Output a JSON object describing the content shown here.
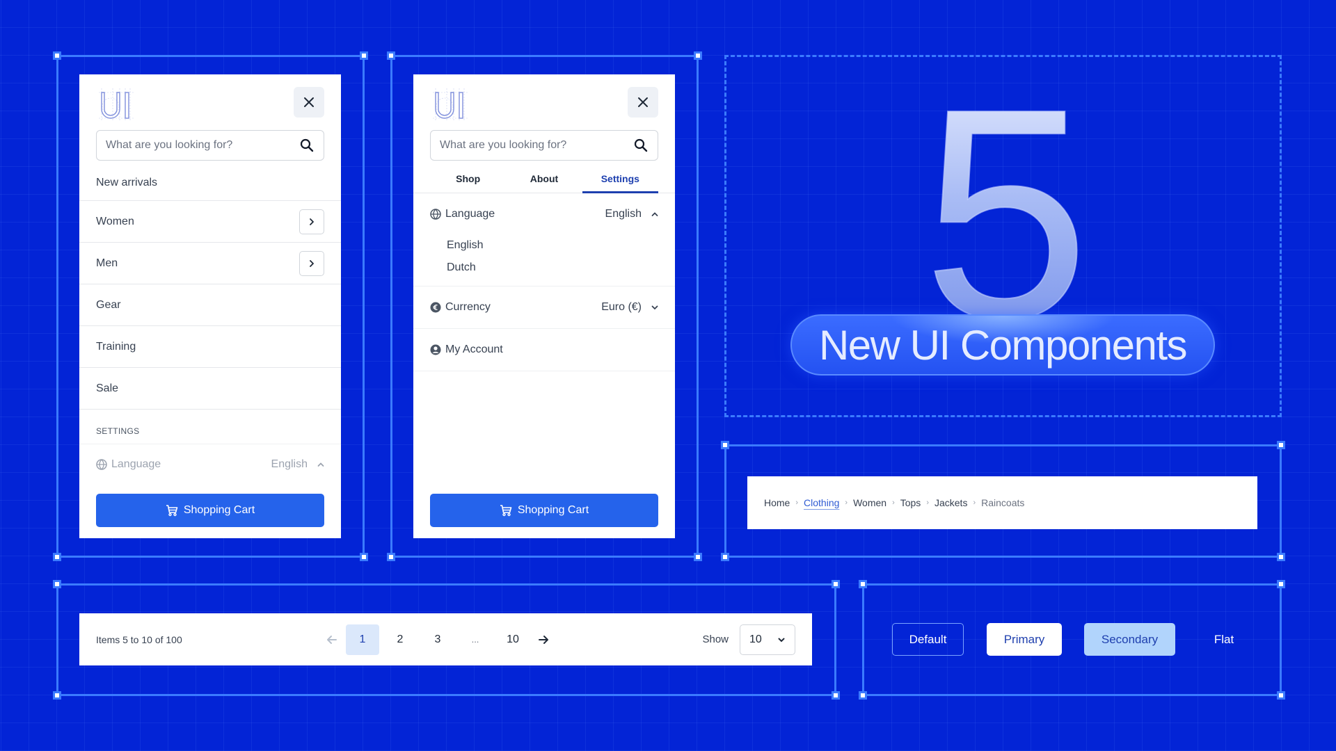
{
  "colors": {
    "background": "#0324d6",
    "frame": "#3b7bff",
    "accent": "#2563eb",
    "active_tab": "#1e40af",
    "secondary_button": "#b1d4fc"
  },
  "menu_panel": {
    "logo": "UI",
    "close_icon": "close-icon",
    "search_placeholder": "What are you looking for?",
    "items": [
      {
        "label": "New arrivals",
        "has_submenu": false
      },
      {
        "label": "Women",
        "has_submenu": true
      },
      {
        "label": "Men",
        "has_submenu": true
      },
      {
        "label": "Gear",
        "has_submenu": false
      },
      {
        "label": "Training",
        "has_submenu": false
      },
      {
        "label": "Sale",
        "has_submenu": false
      }
    ],
    "settings_heading": "SETTINGS",
    "language_label": "Language",
    "language_value": "English",
    "cart_button": "Shopping Cart"
  },
  "settings_panel": {
    "logo": "UI",
    "search_placeholder": "What are you looking for?",
    "tabs": [
      {
        "label": "Shop",
        "active": false
      },
      {
        "label": "About",
        "active": false
      },
      {
        "label": "Settings",
        "active": true
      }
    ],
    "language": {
      "label": "Language",
      "value": "English",
      "expanded": true,
      "options": [
        "English",
        "Dutch"
      ]
    },
    "currency": {
      "label": "Currency",
      "value": "Euro (€)",
      "expanded": false
    },
    "account": {
      "label": "My Account"
    },
    "cart_button": "Shopping Cart"
  },
  "headline": {
    "number": "5",
    "title": "New UI Components"
  },
  "breadcrumb": {
    "items": [
      {
        "label": "Home",
        "style": "plain"
      },
      {
        "label": "Clothing",
        "style": "link"
      },
      {
        "label": "Women",
        "style": "plain"
      },
      {
        "label": "Tops",
        "style": "plain"
      },
      {
        "label": "Jackets",
        "style": "plain"
      },
      {
        "label": "Raincoats",
        "style": "current"
      }
    ],
    "separator": "›"
  },
  "pagination": {
    "info": "Items 5 to 10 of 100",
    "pages": [
      "1",
      "2",
      "3"
    ],
    "ellipsis": "...",
    "last_page": "10",
    "current_page": "1",
    "show_label": "Show",
    "page_size": "10"
  },
  "buttons": {
    "default": "Default",
    "primary": "Primary",
    "secondary": "Secondary",
    "flat": "Flat"
  }
}
